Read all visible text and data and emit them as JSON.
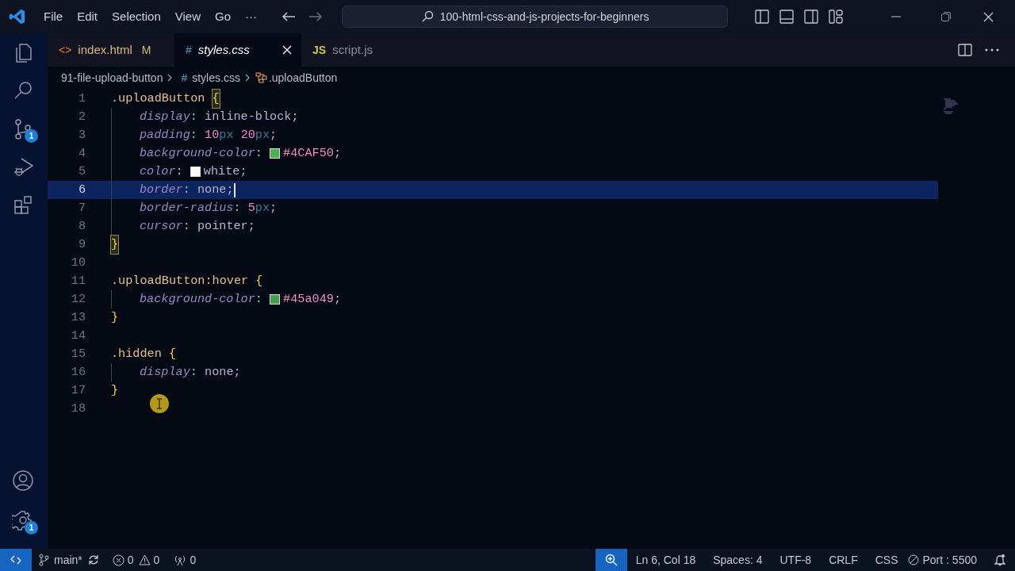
{
  "title_bar": {
    "menus": [
      "File",
      "Edit",
      "Selection",
      "View",
      "Go",
      "···"
    ],
    "search": "100-html-css-and-js-projects-for-beginners"
  },
  "activity_bar": {
    "items": [
      {
        "kind": "explorer"
      },
      {
        "kind": "search"
      },
      {
        "kind": "source-control",
        "badge": "1"
      },
      {
        "kind": "run"
      },
      {
        "kind": "extensions"
      }
    ],
    "bottom": [
      {
        "kind": "account"
      },
      {
        "kind": "settings",
        "badge": "1"
      }
    ]
  },
  "tabs": [
    {
      "kind": "html",
      "icon": "<>",
      "label": "index.html",
      "status": "M",
      "selected": false
    },
    {
      "kind": "css",
      "icon": "#",
      "label": "styles.css",
      "selected": true
    },
    {
      "kind": "js",
      "icon": "JS",
      "label": "script.js",
      "selected": false
    }
  ],
  "breadcrumb": {
    "folder": "91-file-upload-button",
    "file_icon": "#",
    "file": "styles.css",
    "symbol": ".uploadButton"
  },
  "code_lines": [
    {
      "number": "1",
      "current": false,
      "indent": false,
      "tokens": [
        {
          "kind": "selector",
          "text": ".uploadButton "
        },
        {
          "kind": "brace",
          "text": "{",
          "matched": true
        }
      ]
    },
    {
      "number": "2",
      "current": false,
      "indent": true,
      "tokens": [
        {
          "kind": "prop",
          "text": "display"
        },
        {
          "kind": "punct",
          "text": ": "
        },
        {
          "kind": "value",
          "text": "inline-block"
        },
        {
          "kind": "punct",
          "text": ";"
        }
      ]
    },
    {
      "number": "3",
      "current": false,
      "indent": true,
      "tokens": [
        {
          "kind": "prop",
          "text": "padding"
        },
        {
          "kind": "punct",
          "text": ": "
        },
        {
          "kind": "num",
          "text": "10"
        },
        {
          "kind": "unit",
          "text": "px "
        },
        {
          "kind": "num",
          "text": "20"
        },
        {
          "kind": "unit",
          "text": "px"
        },
        {
          "kind": "punct",
          "text": ";"
        }
      ]
    },
    {
      "number": "4",
      "current": false,
      "indent": true,
      "tokens": [
        {
          "kind": "prop",
          "text": "background-color"
        },
        {
          "kind": "punct",
          "text": ": "
        },
        {
          "kind": "swatch",
          "color": "#4caf50"
        },
        {
          "kind": "num",
          "text": "#4CAF50"
        },
        {
          "kind": "punct",
          "text": ";"
        }
      ]
    },
    {
      "number": "5",
      "current": false,
      "indent": true,
      "tokens": [
        {
          "kind": "prop",
          "text": "color"
        },
        {
          "kind": "punct",
          "text": ": "
        },
        {
          "kind": "swatch",
          "color": "#ffffff"
        },
        {
          "kind": "value",
          "text": "white"
        },
        {
          "kind": "punct",
          "text": ";"
        }
      ]
    },
    {
      "number": "6",
      "current": true,
      "indent": true,
      "tokens": [
        {
          "kind": "prop",
          "text": "border"
        },
        {
          "kind": "punct",
          "text": ": "
        },
        {
          "kind": "value",
          "text": "none"
        },
        {
          "kind": "punct",
          "text": ";"
        }
      ]
    },
    {
      "number": "7",
      "current": false,
      "indent": true,
      "tokens": [
        {
          "kind": "prop",
          "text": "border-radius"
        },
        {
          "kind": "punct",
          "text": ": "
        },
        {
          "kind": "num",
          "text": "5"
        },
        {
          "kind": "unit",
          "text": "px"
        },
        {
          "kind": "punct",
          "text": ";"
        }
      ]
    },
    {
      "number": "8",
      "current": false,
      "indent": true,
      "tokens": [
        {
          "kind": "prop",
          "text": "cursor"
        },
        {
          "kind": "punct",
          "text": ": "
        },
        {
          "kind": "value",
          "text": "pointer"
        },
        {
          "kind": "punct",
          "text": ";"
        }
      ]
    },
    {
      "number": "9",
      "current": false,
      "indent": false,
      "tokens": [
        {
          "kind": "brace",
          "text": "}",
          "matched": true
        }
      ]
    },
    {
      "number": "10",
      "current": false,
      "indent": false
    },
    {
      "number": "11",
      "current": false,
      "indent": false,
      "tokens": [
        {
          "kind": "selector",
          "text": ".uploadButton:hover "
        },
        {
          "kind": "brace",
          "text": "{",
          "matched": false
        }
      ]
    },
    {
      "number": "12",
      "current": false,
      "indent": true,
      "tokens": [
        {
          "kind": "prop",
          "text": "background-color"
        },
        {
          "kind": "punct",
          "text": ": "
        },
        {
          "kind": "swatch",
          "color": "#45a049"
        },
        {
          "kind": "num",
          "text": "#45a049"
        },
        {
          "kind": "punct",
          "text": ";"
        }
      ]
    },
    {
      "number": "13",
      "current": false,
      "indent": false,
      "tokens": [
        {
          "kind": "brace",
          "text": "}",
          "matched": false
        }
      ]
    },
    {
      "number": "14",
      "current": false,
      "indent": false
    },
    {
      "number": "15",
      "current": false,
      "indent": false,
      "tokens": [
        {
          "kind": "selector",
          "text": ".hidden "
        },
        {
          "kind": "brace",
          "text": "{",
          "matched": false
        }
      ]
    },
    {
      "number": "16",
      "current": false,
      "indent": true,
      "tokens": [
        {
          "kind": "prop",
          "text": "display"
        },
        {
          "kind": "punct",
          "text": ": "
        },
        {
          "kind": "value",
          "text": "none"
        },
        {
          "kind": "punct",
          "text": ";"
        }
      ]
    },
    {
      "number": "17",
      "current": false,
      "indent": false,
      "tokens": [
        {
          "kind": "brace",
          "text": "}",
          "matched": false
        }
      ]
    },
    {
      "number": "18",
      "current": false,
      "indent": false
    }
  ],
  "status_bar": {
    "branch": "main*",
    "errors": "0",
    "warnings": "0",
    "ports": "0",
    "position": "Ln 6, Col 18",
    "spaces": "Spaces: 4",
    "encoding": "UTF-8",
    "eol": "CRLF",
    "language": "CSS",
    "port": "Port : 5500"
  }
}
